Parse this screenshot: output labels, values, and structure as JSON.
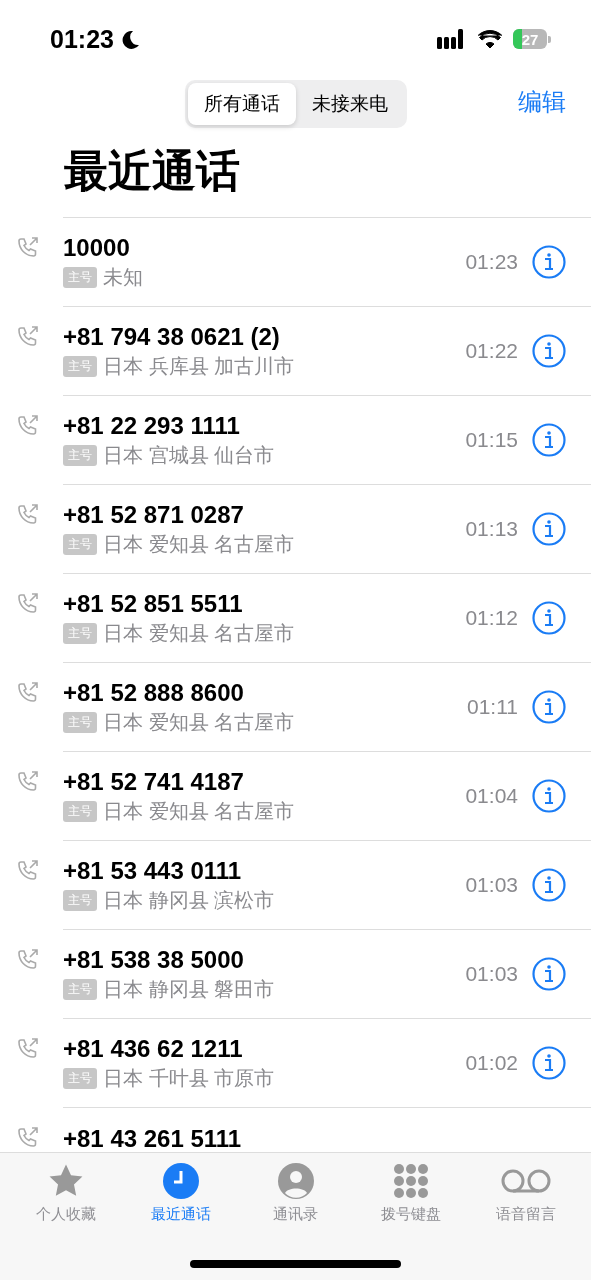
{
  "status_bar": {
    "time": "01:23",
    "battery": "27"
  },
  "segments": [
    {
      "label": "所有通话",
      "selected": true
    },
    {
      "label": "未接来电",
      "selected": false
    }
  ],
  "edit": "编辑",
  "title": "最近通话",
  "calls": [
    {
      "number": "10000",
      "badge": "主号",
      "location": "未知",
      "time": "01:23"
    },
    {
      "number": "+81 794 38 0621 (2)",
      "badge": "主号",
      "location": "日本 兵库县 加古川市",
      "time": "01:22"
    },
    {
      "number": "+81 22 293 1111",
      "badge": "主号",
      "location": "日本 宫城县 仙台市",
      "time": "01:15"
    },
    {
      "number": "+81 52 871 0287",
      "badge": "主号",
      "location": "日本 爱知县 名古屋市",
      "time": "01:13"
    },
    {
      "number": "+81 52 851 5511",
      "badge": "主号",
      "location": "日本 爱知县 名古屋市",
      "time": "01:12"
    },
    {
      "number": "+81 52 888 8600",
      "badge": "主号",
      "location": "日本 爱知县 名古屋市",
      "time": "01:11"
    },
    {
      "number": "+81 52 741 4187",
      "badge": "主号",
      "location": "日本 爱知县 名古屋市",
      "time": "01:04"
    },
    {
      "number": "+81 53 443 0111",
      "badge": "主号",
      "location": "日本 静冈县 滨松市",
      "time": "01:03"
    },
    {
      "number": "+81 538 38 5000",
      "badge": "主号",
      "location": "日本 静冈县 磐田市",
      "time": "01:03"
    },
    {
      "number": "+81 436 62 1211",
      "badge": "主号",
      "location": "日本 千叶县 市原市",
      "time": "01:02"
    },
    {
      "number": "+81 43 261 5111"
    }
  ],
  "tab_bar": [
    {
      "kind": "favorites",
      "label": "个人收藏",
      "selected": false
    },
    {
      "kind": "recents",
      "label": "最近通话",
      "selected": true
    },
    {
      "kind": "contacts",
      "label": "通讯录",
      "selected": false
    },
    {
      "kind": "keypad",
      "label": "拨号键盘",
      "selected": false
    },
    {
      "kind": "voicemail",
      "label": "语音留言",
      "selected": false
    }
  ]
}
